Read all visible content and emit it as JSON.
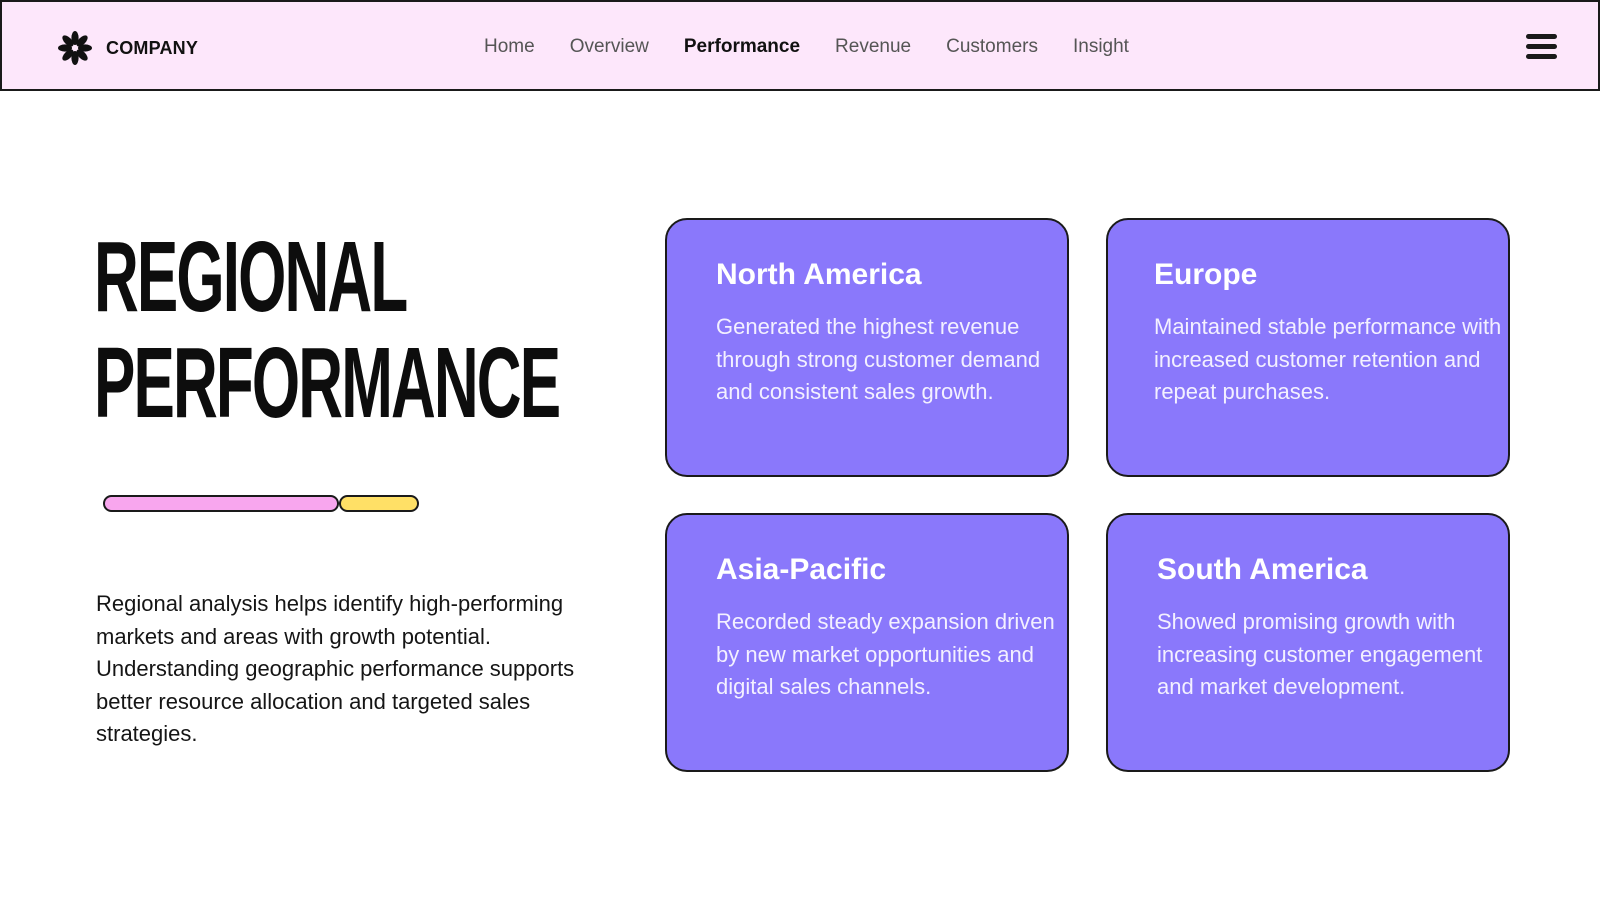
{
  "header": {
    "brand_name": "COMPANY",
    "brand_icon": "flower-icon",
    "nav": [
      {
        "label": "Home",
        "active": false
      },
      {
        "label": "Overview",
        "active": false
      },
      {
        "label": "Performance",
        "active": true
      },
      {
        "label": "Revenue",
        "active": false
      },
      {
        "label": "Customers",
        "active": false
      },
      {
        "label": "Insight",
        "active": false
      }
    ],
    "menu_icon": "hamburger-menu-icon"
  },
  "hero": {
    "title_line1": "REGIONAL",
    "title_line2": "PERFORMANCE",
    "description": "Regional analysis helps identify high-performing markets and areas with growth potential. Understanding geographic performance supports better resource allocation and targeted sales strategies."
  },
  "regions": [
    {
      "title": "North America",
      "text": "Generated the highest revenue through strong customer demand and consistent sales growth."
    },
    {
      "title": "Europe",
      "text": "Maintained stable performance with increased customer retention and repeat purchases."
    },
    {
      "title": "Asia-Pacific",
      "text": "Recorded steady expansion driven by new market opportunities and digital sales channels."
    },
    {
      "title": "South America",
      "text": "Showed promising growth with increasing customer engagement and market development."
    }
  ],
  "colors": {
    "header_bg": "#fde7fb",
    "card_bg": "#8a78fb",
    "accent_pink": "#f8a6ee",
    "accent_yellow": "#ffe066"
  }
}
